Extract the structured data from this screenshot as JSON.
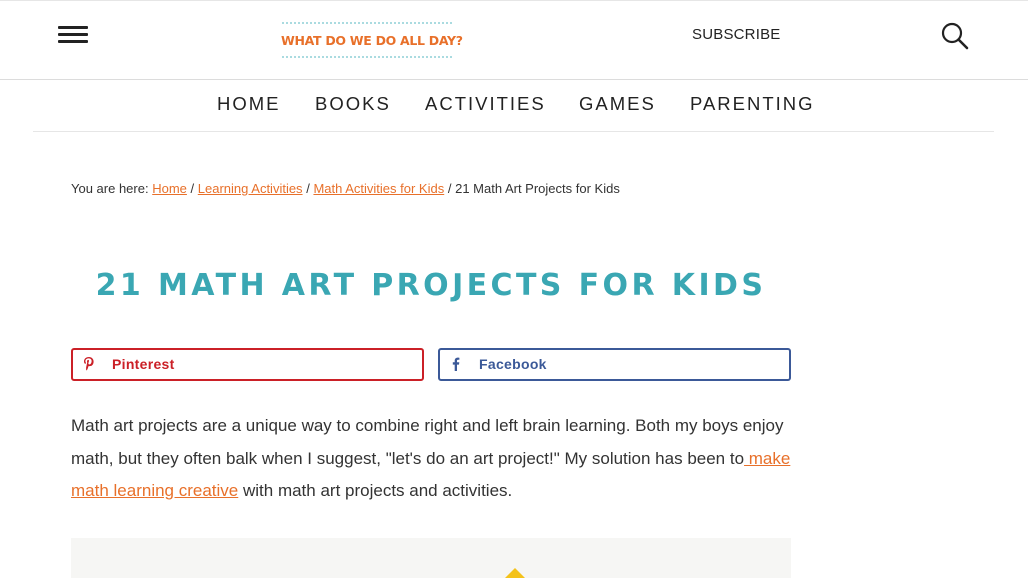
{
  "header": {
    "logo_text": "WHAT DO WE DO ALL DAY?",
    "subscribe_label": "SUBSCRIBE",
    "menu_icon": "hamburger-menu-icon",
    "search_icon": "search-icon"
  },
  "nav": {
    "items": [
      "HOME",
      "BOOKS",
      "ACTIVITIES",
      "GAMES",
      "PARENTING"
    ]
  },
  "breadcrumb": {
    "prefix": "You are here:",
    "links": [
      "Home",
      "Learning Activities",
      "Math Activities for Kids"
    ],
    "separator": "/",
    "current": "21 Math Art Projects for Kids"
  },
  "article": {
    "title": "21 MATH ART PROJECTS FOR KIDS",
    "intro_part1": "Math art projects are a unique way to combine right and left brain learning. Both my boys enjoy math, but they often balk when I suggest, \"let's do an art project!\" My solution has been to",
    "intro_link": " make math learning creative",
    "intro_part2": " with math art projects and activities."
  },
  "share": {
    "pinterest_label": "Pinterest",
    "facebook_label": "Facebook",
    "pinterest_color": "#cb2027",
    "facebook_color": "#3b5998"
  },
  "colors": {
    "accent_orange": "#e8702a",
    "title_teal": "#3aa7b3"
  }
}
